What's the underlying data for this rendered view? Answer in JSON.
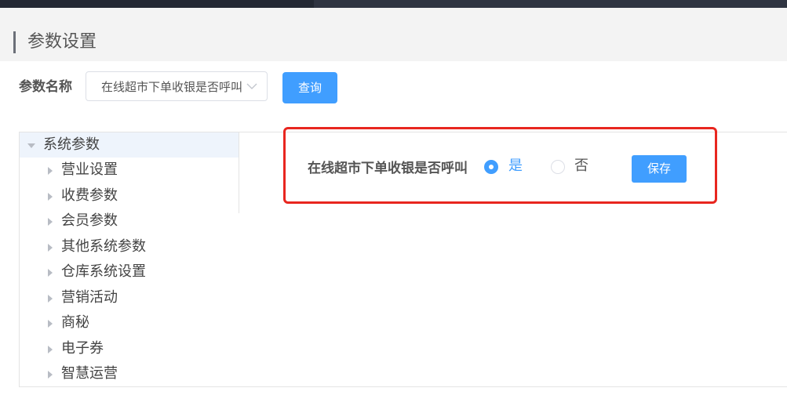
{
  "page": {
    "title": "参数设置"
  },
  "filter": {
    "label": "参数名称",
    "selected_value": "在线超市下单收银是否呼叫",
    "query_button": "查询"
  },
  "tree": {
    "root": "系统参数",
    "children": [
      "营业设置",
      "收费参数",
      "会员参数",
      "其他系统参数",
      "仓库系统设置",
      "营销活动",
      "商秘",
      "电子券",
      "智慧运营"
    ]
  },
  "param": {
    "label": "在线超市下单收银是否呼叫",
    "options": [
      {
        "label": "是",
        "selected": true
      },
      {
        "label": "否",
        "selected": false
      }
    ],
    "save_button": "保存"
  },
  "colors": {
    "accent": "#409eff",
    "highlight_border": "#e8261f",
    "header_bg": "#f3f3f3",
    "topbar": "#2f3441"
  }
}
